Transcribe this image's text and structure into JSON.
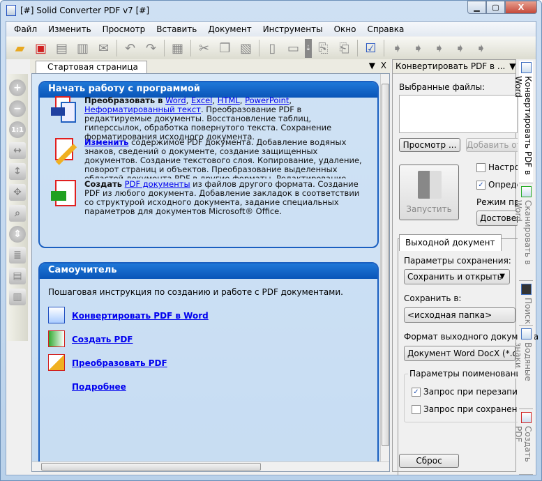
{
  "window": {
    "title": "[#] Solid Converter PDF v7 [#]",
    "min": "▁",
    "max": "▢",
    "close": "X"
  },
  "menu": [
    "Файл",
    "Изменить",
    "Просмотр",
    "Вставить",
    "Документ",
    "Инструменты",
    "Окно",
    "Справка"
  ],
  "doc_tab": {
    "label": "Стартовая страница",
    "menu": "▼",
    "close": "X"
  },
  "start_panel": {
    "title": "Начать работу с программой",
    "convert": {
      "bold": "Преобразовать в",
      "links": [
        "Word",
        "Excel",
        "HTML",
        "PowerPoint",
        "Неформатированный текст"
      ],
      "text": ". Преобразование PDF в редактируемые документы. Восстановление таблиц, гиперссылок, обработка повернутого текста. Сохранение форматирования исходного документа."
    },
    "edit": {
      "link": "Изменить",
      "text": " содержимое PDF документа. Добавление водяных знаков, сведений о документе, создание защищенных документов. Создание текстового слоя. Копирование, удаление, поворот страниц и объектов. Преобразование выделенных областей документа PDF в другие форматы. Редактирование документа PDF."
    },
    "create": {
      "bold": "Создать",
      "link": "PDF документы",
      "text": " из файлов другого формата. Создание PDF из любого документа. Добавление закладок в соответствии со структурой исходного документа, задание специальных параметров для документов Microsoft® Office."
    }
  },
  "tutorial_panel": {
    "title": "Самоучитель",
    "intro": "Пошаговая инструкция по созданию и работе с  PDF документами.",
    "links": [
      "Конвертировать PDF в Word",
      "Создать PDF ",
      "Преобразовать PDF",
      "Подробнее"
    ]
  },
  "right_pane": {
    "title": "Конвертировать PDF в ...",
    "menu": "▼",
    "close": "X",
    "selected_files_label": "Выбранные файлы:",
    "browse": "Просмотр ...",
    "add": "Добавить от",
    "run": "Запустить",
    "opt1": {
      "label": "Настро",
      "checked": false
    },
    "opt2": {
      "label": "Определ",
      "checked": true
    },
    "mode_label": "Режим пре",
    "mode_value": "Достовер",
    "tab": "Выходной документ",
    "save_params_label": "Параметры сохранения:",
    "save_params_value": "Сохранить и открыть",
    "save_in_label": "Сохранить в:",
    "save_in_value": "<исходная папка>",
    "format_label": "Формат выходного документа",
    "format_value": "Документ Word DocX  (*.docx)",
    "naming_group": "Параметры поименования",
    "ask_overwrite": {
      "label": "Запрос при перезаписи",
      "checked": true
    },
    "ask_save": {
      "label": "Запрос при сохранении",
      "checked": false
    },
    "reset": "Сброс"
  },
  "side_tabs": [
    "Конвертировать PDF в Word",
    "Сканировать в Word",
    "Поиск",
    "Водяные знаки",
    "Создать PDF"
  ]
}
